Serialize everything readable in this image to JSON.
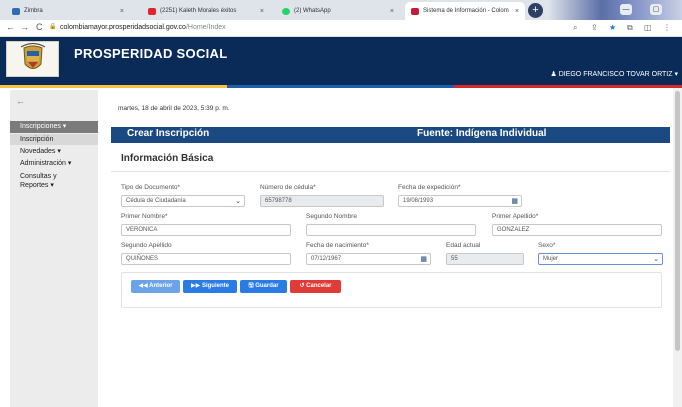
{
  "browser": {
    "tabs": [
      {
        "label": "Zimbra",
        "close": "×",
        "color": "#2f6db5"
      },
      {
        "label": "(2251) Kaleth Morales éxitos",
        "close": "×",
        "color": "#e0242b"
      },
      {
        "label": "(2) WhatsApp",
        "close": "×",
        "color": "#25d366"
      },
      {
        "label": "Sistema de Información - Colom",
        "close": "×",
        "color": "#c21c39"
      }
    ],
    "newtab": "+",
    "url_host": "colombiamayor.prosperidadsocial.gov.co",
    "url_path": "/Home/Index",
    "nav": {
      "back": "←",
      "forward": "→",
      "reload": "C",
      "lock": "🔒"
    },
    "tools": {
      "search": "⌕",
      "share": "⇪",
      "star": "★",
      "ext": "⧉",
      "split": "◫",
      "menu": "⋮"
    },
    "window": {
      "min": "—",
      "restore": "▢"
    }
  },
  "header": {
    "brand": "PROSPERIDAD SOCIAL",
    "user": "DIEGO FRANCISCO TOVAR ORTIZ",
    "user_icon": "person-icon"
  },
  "sidebar": {
    "back": "←",
    "items": [
      {
        "label": "Inscripciones ▾",
        "state": "head"
      },
      {
        "label": "Inscripción",
        "state": "active"
      },
      {
        "label": "Novedades ▾",
        "state": ""
      },
      {
        "label": "Administración ▾",
        "state": ""
      },
      {
        "label": "Consultas y",
        "state": ""
      },
      {
        "label": "Reportes ▾",
        "state": ""
      }
    ]
  },
  "page": {
    "date": "martes, 18 de abril de 2023, 5:39 p. m.",
    "band_left": "Crear Inscripción",
    "band_right": "Fuente: Indígena Individual",
    "section_title": "Información Básica"
  },
  "form": {
    "tipo_doc_label": "Tipo de Documento*",
    "tipo_doc_value": "Cédula de Ciudadanía",
    "cedula_label": "Número de cédula*",
    "cedula_value": "65798778",
    "fecha_exp_label": "Fecha de expedición*",
    "fecha_exp_value": "19/08/1993",
    "primer_nombre_label": "Primer Nombre*",
    "primer_nombre_value": "VERONICA",
    "segundo_nombre_label": "Segundo Nombre",
    "segundo_nombre_value": "",
    "primer_apellido_label": "Primer Apellido*",
    "primer_apellido_value": "GONZALEZ",
    "segundo_apellido_label": "Segundo Apellido",
    "segundo_apellido_value": "QUIÑONES",
    "fecha_nac_label": "Fecha de nacimiento*",
    "fecha_nac_value": "07/12/1967",
    "edad_label": "Edad actual",
    "edad_value": "55",
    "sexo_label": "Sexo*",
    "sexo_value": "Mujer"
  },
  "buttons": {
    "anterior": "◀◀ Anterior",
    "siguiente": "▶▶ Siguiente",
    "guardar": "🖫 Guardar",
    "cancelar": "↺ Cancelar"
  },
  "colors": {
    "header_bg": "#0a2a57",
    "band_bg": "#1b4a82",
    "btn_blue": "#2a7be4",
    "btn_light_blue": "#6aa3e8",
    "btn_red": "#e03b36",
    "stripe": [
      "#f6c343",
      "#1f5ea8",
      "#d62b2b"
    ]
  }
}
